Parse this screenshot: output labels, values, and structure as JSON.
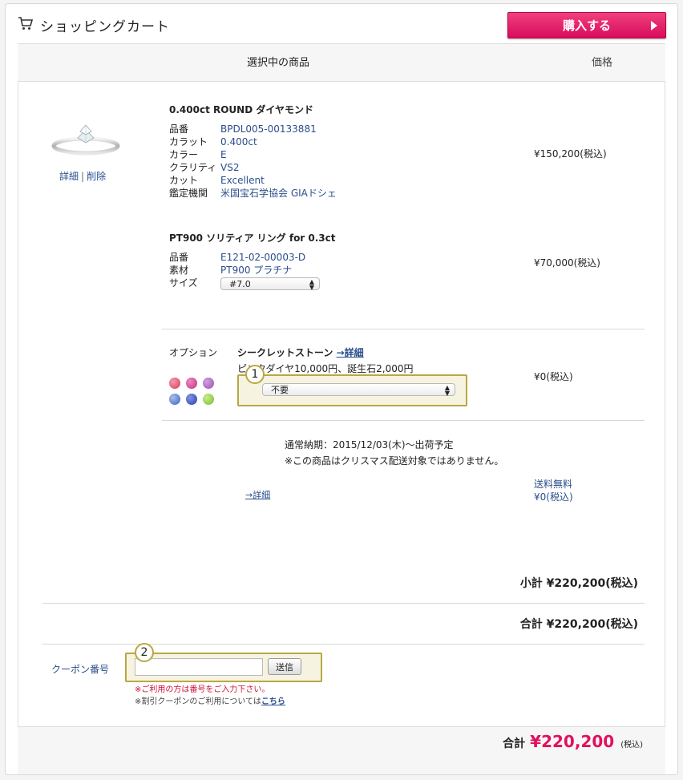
{
  "header": {
    "icon": "cart-icon",
    "title": "ショッピングカート",
    "buy_button": "購入する"
  },
  "table": {
    "col_product": "選択中の商品",
    "col_price": "価格"
  },
  "item_links": {
    "detail": "詳細",
    "separator": "|",
    "delete": "削除"
  },
  "diamond": {
    "title": "0.400ct ROUND ダイヤモンド",
    "specs": [
      {
        "label": "品番",
        "value": "BPDL005-00133881"
      },
      {
        "label": "カラット",
        "value": "0.400ct"
      },
      {
        "label": "カラー",
        "value": "E"
      },
      {
        "label": "クラリティ",
        "value": "VS2"
      },
      {
        "label": "カット",
        "value": "Excellent"
      },
      {
        "label": "鑑定機関",
        "value": "米国宝石学協会 GIAドシェ"
      }
    ],
    "price": "¥150,200(税込)"
  },
  "ring": {
    "title": "PT900 ソリティア リング for 0.3ct",
    "specs": [
      {
        "label": "品番",
        "value": "E121-02-00003-D"
      },
      {
        "label": "素材",
        "value": "PT900 プラチナ"
      }
    ],
    "size_label": "サイズ",
    "size_value": "#7.0",
    "price": "¥70,000(税込)"
  },
  "option": {
    "label": "オプション",
    "title": "シークレットストーン",
    "detail_link": "→詳細",
    "description": "ピンクダイヤ10,000円、誕生石2,000円",
    "select_value": "不要",
    "price": "¥0(税込)",
    "gem_colors": [
      "#d43a5a",
      "#c2307a",
      "#9a4fb0",
      "#3a5fb8",
      "#2a3fa8",
      "#7ab830"
    ]
  },
  "shipping": {
    "date": "通常納期：2015/12/03(木)〜出荷予定",
    "note": "※この商品はクリスマス配送対象ではありません。",
    "detail_link": "→詳細",
    "free_label": "送料無料",
    "free_price": "¥0(税込)"
  },
  "subtotal": "小計 ¥220,200(税込)",
  "total": "合計 ¥220,200(税込)",
  "coupon": {
    "label": "クーポン番号",
    "value": "",
    "submit": "送信",
    "note1": "※ご利用の方は番号をご入力下さい。",
    "note2_prefix": "※割引クーポンのご利用については",
    "note2_link": "こちら"
  },
  "grand_total": {
    "label": "合計",
    "value": "¥220,200",
    "tax": "(税込)"
  },
  "annotations": {
    "badge1": "1",
    "badge2": "2"
  },
  "colors": {
    "accent": "#e0115f",
    "link": "#2a4e8c",
    "highlight": "#b8a842"
  }
}
